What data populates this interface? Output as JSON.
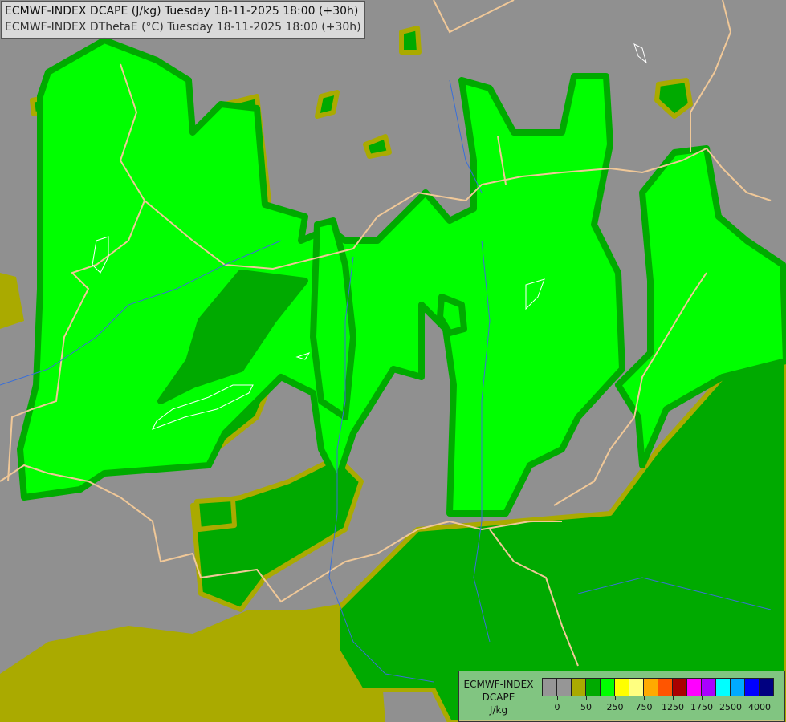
{
  "header": {
    "line1": "ECMWF-INDEX DCAPE (J/kg) Tuesday 18-11-2025 18:00 (+30h)",
    "line2": "ECMWF-INDEX DThetaE (°C) Tuesday 18-11-2025 18:00 (+30h)"
  },
  "legend": {
    "title_lines": [
      "ECMWF-INDEX",
      "DCAPE",
      "J/kg"
    ],
    "colors": [
      "#969696",
      "#969696",
      "#aaaa00",
      "#00aa00",
      "#00ff00",
      "#ffff00",
      "#ffff80",
      "#ffaa00",
      "#ff5500",
      "#aa0000",
      "#ff00ff",
      "#aa00ff",
      "#00ffff",
      "#00aaff",
      "#0000ff",
      "#000080"
    ],
    "tick_labels": [
      "0",
      "50",
      "250",
      "750",
      "1250",
      "1750",
      "2500",
      "4000"
    ]
  },
  "map_colors": {
    "background": "#909090",
    "olive": "#aaaa00",
    "dark_green": "#00aa00",
    "lime": "#00ff00",
    "borders": "#f0c898",
    "rivers": "#3a6fd8",
    "thetae_contours": "#ffffff"
  }
}
